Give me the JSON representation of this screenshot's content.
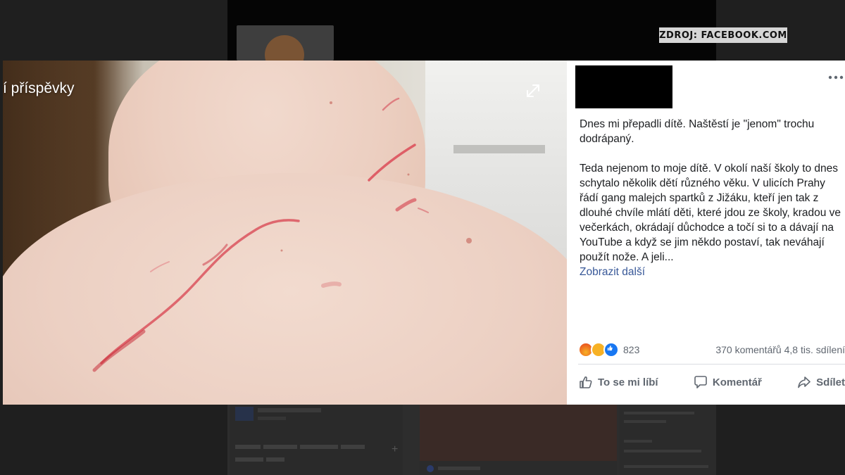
{
  "source": {
    "label": "ZDROJ: FACEBOOK.COM"
  },
  "photo": {
    "title": "í příspěvky",
    "expand_icon": "expand-icon"
  },
  "post": {
    "paragraphs": [
      "Dnes mi přepadli dítě. Naštěstí je \"jenom\" trochu dodrápaný.",
      "Teda nejenom to moje dítě. V okolí naší školy to dnes schytalo několik dětí různého věku. V ulicích Prahy řádí gang malejch spartků z Jižáku, kteří jen tak z dlouhé chvíle mlátí děti, které jdou ze školy, kradou ve večerkách, okrádají důchodce a točí si to a dávají na YouTube a když se jim někdo postaví, tak neváhají použít nože. A jeli..."
    ],
    "show_more": "Zobrazit další",
    "more_icon": "more-options-icon"
  },
  "reactions": {
    "icons": [
      "angry-reaction-icon",
      "sad-reaction-icon",
      "like-reaction-icon"
    ],
    "count": "823",
    "stats": "370 komentářů  4,8 tis. sdílení"
  },
  "actions": {
    "like": "To se mi líbí",
    "comment": "Komentář",
    "share": "Sdílet"
  },
  "colors": {
    "link": "#385898",
    "like_blue": "#1877f2",
    "text": "#1c1e21",
    "muted": "#606770",
    "source_bg": "#d6d6d6"
  }
}
